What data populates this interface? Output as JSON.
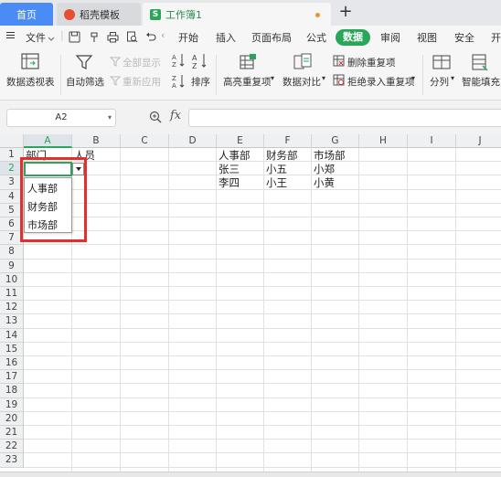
{
  "tabs": {
    "home": "首页",
    "template": "稻壳模板",
    "workbook": "工作簿1",
    "new_tab": "+"
  },
  "menu": {
    "file": "文件",
    "items": [
      "开始",
      "插入",
      "页面布局",
      "公式",
      "数据",
      "审阅",
      "视图",
      "安全",
      "开"
    ],
    "active": "数据"
  },
  "ribbon": {
    "pivot": "数据透视表",
    "autofilter": "自动筛选",
    "show_all": "全部显示",
    "reapply": "重新应用",
    "sort": "排序",
    "highlight_dup": "高亮重复项",
    "compare": "数据对比",
    "delete_dup": "删除重复项",
    "reject_dup": "拒绝录入重复项",
    "split": "分列",
    "smart_fill": "智能填充"
  },
  "formula_bar": {
    "name_box": "A2",
    "fx": "fx",
    "value": ""
  },
  "columns": [
    "A",
    "B",
    "C",
    "D",
    "E",
    "F",
    "G",
    "H",
    "I",
    "J"
  ],
  "rows": [
    "1",
    "2",
    "3",
    "4",
    "5",
    "6",
    "7",
    "8",
    "9",
    "10",
    "11",
    "12",
    "13",
    "14",
    "15",
    "16",
    "17",
    "18",
    "19",
    "20",
    "21",
    "22",
    "23"
  ],
  "cells": {
    "A1": "部门",
    "B1": "人员",
    "E1": "人事部",
    "F1": "财务部",
    "G1": "市场部",
    "E2": "张三",
    "F2": "小五",
    "G2": "小郑",
    "E3": "李四",
    "F3": "小王",
    "G3": "小黄"
  },
  "dropdown": {
    "options": [
      "人事部",
      "财务部",
      "市场部"
    ]
  },
  "colors": {
    "accent": "#2aa65a",
    "home_tab": "#4b8bf5",
    "highlight": "#e03030"
  }
}
